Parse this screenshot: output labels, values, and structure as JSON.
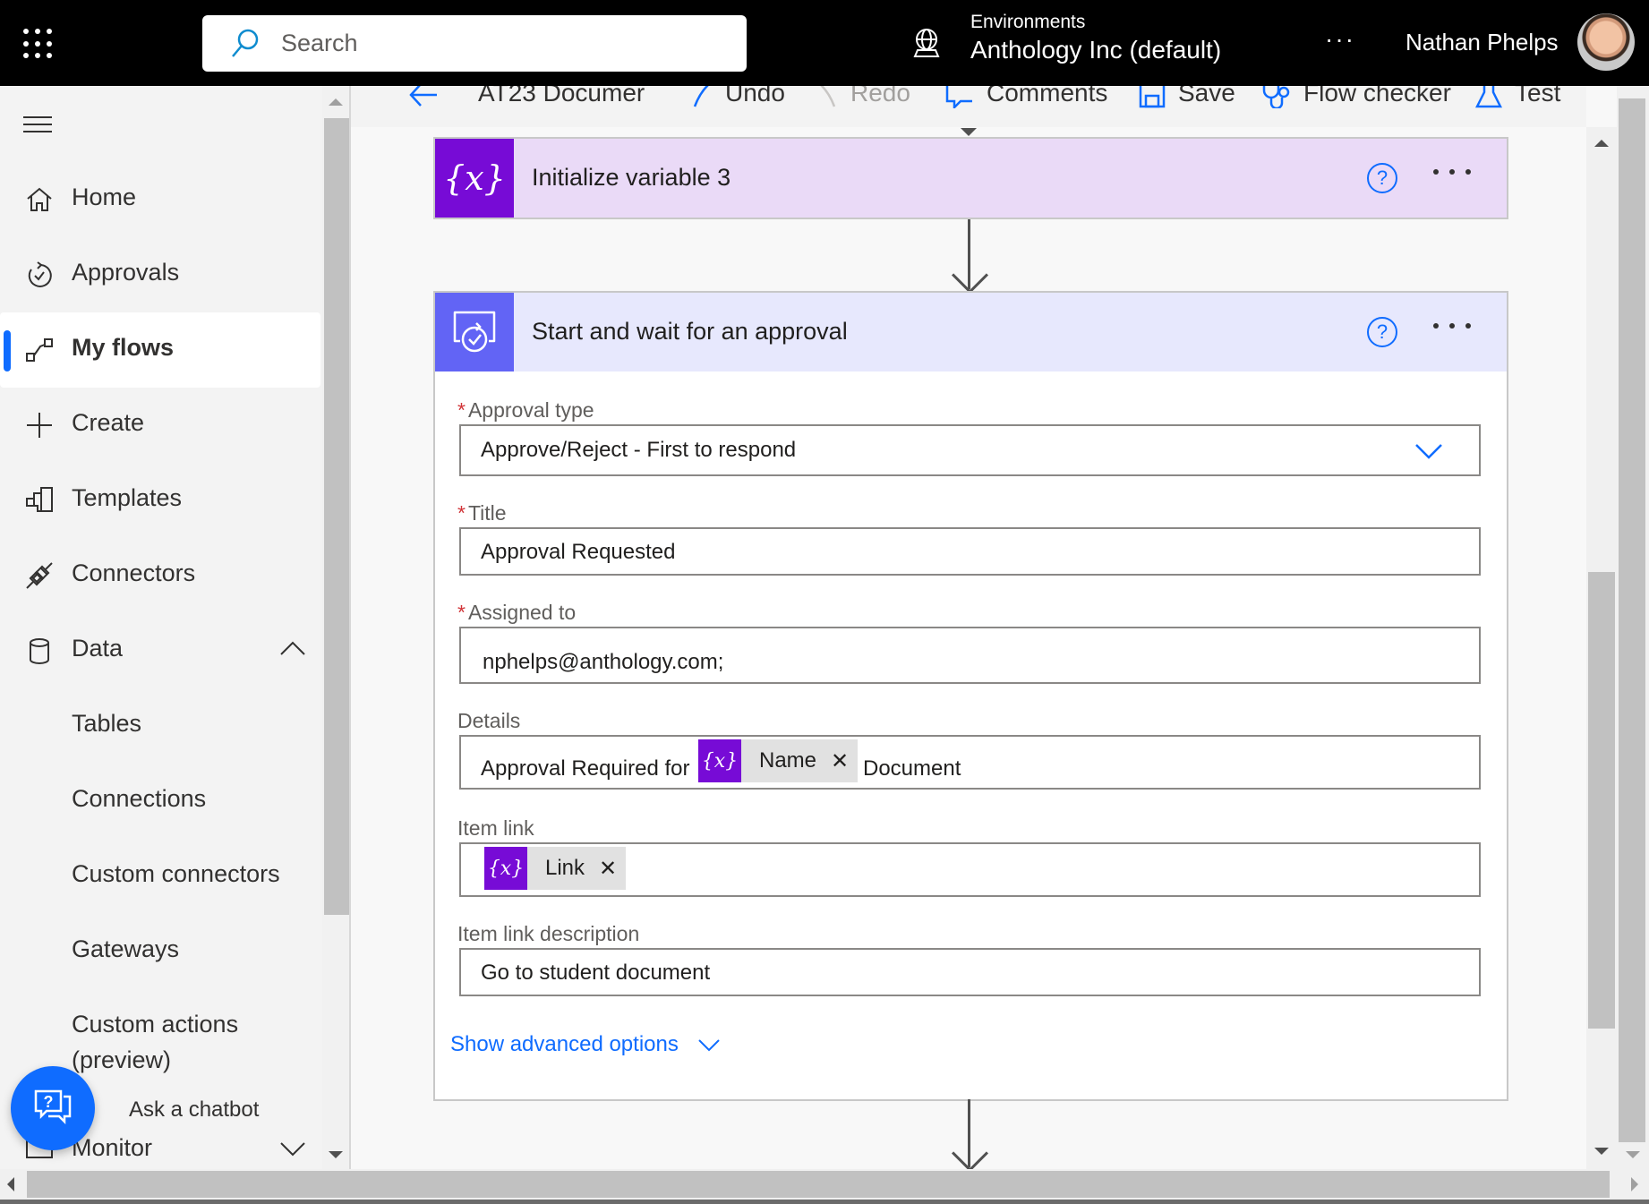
{
  "header": {
    "search_placeholder": "Search",
    "environment_label": "Environments",
    "environment_name": "Anthology Inc (default)",
    "more_label": "···",
    "user_name": "Nathan Phelps"
  },
  "sidebar": {
    "items": [
      {
        "label": "Home",
        "icon": "home-icon"
      },
      {
        "label": "Approvals",
        "icon": "approvals-icon"
      },
      {
        "label": "My flows",
        "icon": "flows-icon",
        "active": true
      },
      {
        "label": "Create",
        "icon": "plus-icon"
      },
      {
        "label": "Templates",
        "icon": "templates-icon"
      },
      {
        "label": "Connectors",
        "icon": "connector-plug-icon"
      },
      {
        "label": "Data",
        "icon": "database-icon",
        "expanded": true
      },
      {
        "label": "Tables"
      },
      {
        "label": "Connections"
      },
      {
        "label": "Custom connectors"
      },
      {
        "label": "Gateways"
      },
      {
        "label": "Custom actions (preview)"
      },
      {
        "label": "Monitor",
        "icon": "monitor-icon"
      }
    ],
    "custom_actions_line1": "Custom actions",
    "custom_actions_line2": "(preview)",
    "chatbot_label": "Ask a chatbot"
  },
  "toolbar": {
    "flow_name": "AT23 Documer",
    "undo": "Undo",
    "redo": "Redo",
    "comments": "Comments",
    "save": "Save",
    "flow_checker": "Flow checker",
    "test": "Test"
  },
  "flow": {
    "steps": [
      {
        "title": "Initialize variable 3",
        "icon": "variable-icon",
        "color": "#770bd6",
        "header_bg": "#eadaf7"
      },
      {
        "title": "Start and wait for an approval",
        "icon": "approval-icon",
        "color": "#6264f5",
        "header_bg": "#e7e8fd"
      }
    ],
    "approval_form": {
      "approval_type": {
        "label": "Approval type",
        "required": true,
        "value": "Approve/Reject - First to respond"
      },
      "title": {
        "label": "Title",
        "required": true,
        "value": "Approval Requested"
      },
      "assigned_to": {
        "label": "Assigned to",
        "required": true,
        "value": "nphelps@anthology.com;"
      },
      "details": {
        "label": "Details",
        "required": false,
        "prefix": "Approval Required for",
        "token": "Name",
        "suffix": "Document"
      },
      "item_link": {
        "label": "Item link",
        "required": false,
        "token": "Link"
      },
      "item_link_description": {
        "label": "Item link description",
        "required": false,
        "value": "Go to student document"
      },
      "show_advanced": "Show advanced options"
    },
    "token_icon_text": "{x}"
  },
  "colors": {
    "accent": "#0f6cff",
    "variable_purple": "#770bd6",
    "approval_indigo": "#6264f5",
    "required_red": "#d13438"
  }
}
